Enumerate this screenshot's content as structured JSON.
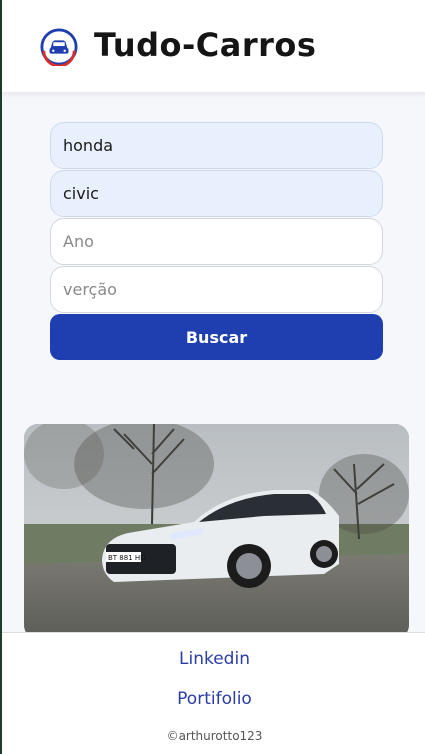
{
  "header": {
    "brand": "Tudo-Carros",
    "logo_icon": "car-logo-icon"
  },
  "search_form": {
    "brand_value": "honda",
    "model_value": "civic",
    "year_placeholder": "Ano",
    "version_placeholder": "verção",
    "button_label": "Buscar"
  },
  "result": {
    "plate_text": "BT 881 HD"
  },
  "footer": {
    "linkedin_label": "Linkedin",
    "portfolio_label": "Portifolio",
    "copyright": "©arthurotto123"
  },
  "colors": {
    "primary": "#1f3fb0",
    "link": "#2a3da5",
    "logo_red": "#d62e2e"
  }
}
